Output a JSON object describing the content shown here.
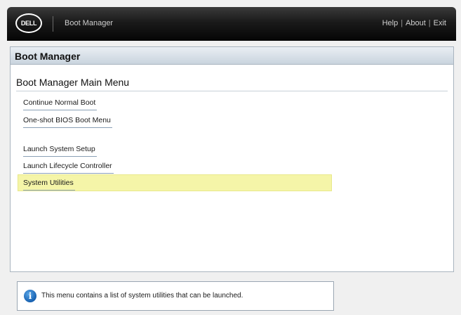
{
  "header": {
    "logo_text": "DELL",
    "title": "Boot Manager",
    "links": [
      "Help",
      "About",
      "Exit"
    ],
    "separator": "|"
  },
  "panel": {
    "title": "Boot Manager",
    "heading": "Boot Manager Main Menu",
    "items": [
      {
        "label": "Continue Normal Boot"
      },
      {
        "label": "One-shot BIOS Boot Menu"
      },
      {
        "label": "Launch System Setup"
      },
      {
        "label": "Launch Lifecycle Controller"
      },
      {
        "label": "System Utilities",
        "selected": true
      }
    ]
  },
  "info": {
    "icon": "info-icon",
    "text": "This menu contains a list of system utilities that can be launched."
  },
  "colors": {
    "header_bg": "#111111",
    "panel_header_bg": "#d5dee7",
    "selection_highlight": "#f5f5a8",
    "info_icon": "#1660b0"
  }
}
